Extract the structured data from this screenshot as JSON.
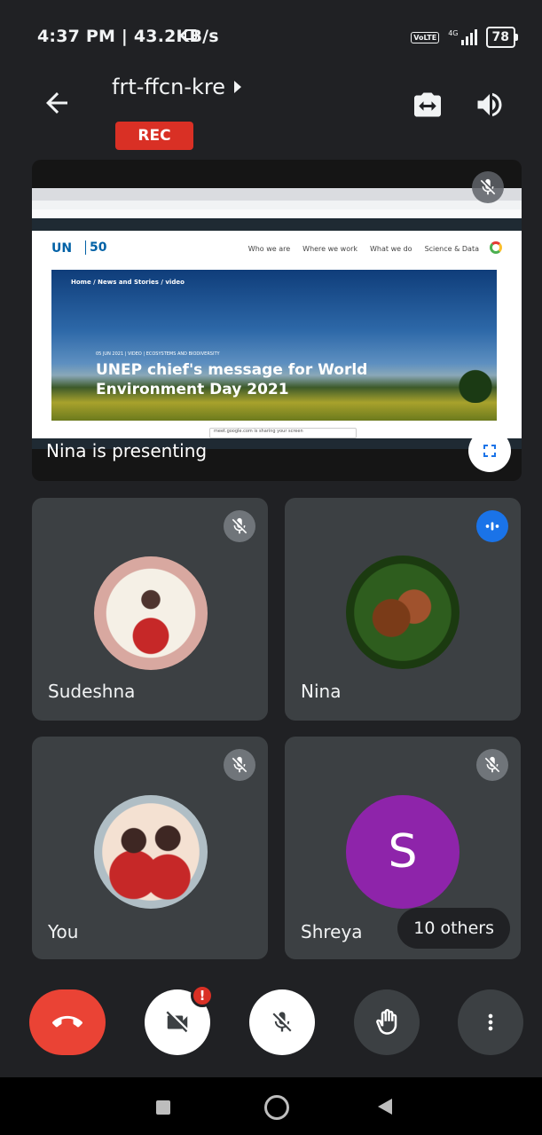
{
  "status_bar": {
    "time_speed": "4:37 PM | 43.2KB/s",
    "volte": "VoLTE",
    "network": "4G",
    "battery": "78"
  },
  "header": {
    "meeting_code": "frt-ffcn-kre",
    "rec_label": "REC"
  },
  "presentation": {
    "presenter_label": "Nina is presenting",
    "screen": {
      "breadcrumb": "Home / News and Stories / video",
      "date_line": "05 JUN 2021 | VIDEO | ECOSYSTEMS AND BIODIVERSITY",
      "headline": "UNEP chief's message for World Environment Day 2021",
      "logo_un": "UN",
      "logo_50": "50",
      "nav_links": [
        "Who we are",
        "Where we work",
        "What we do",
        "Science & Data"
      ],
      "share_text": "meet.google.com is sharing your screen"
    }
  },
  "participants": [
    {
      "name": "Sudeshna",
      "status": "muted"
    },
    {
      "name": "Nina",
      "status": "speaking"
    },
    {
      "name": "You",
      "status": "muted"
    },
    {
      "name": "Shreya",
      "status": "muted",
      "initial": "S"
    }
  ],
  "others_label": "10 others",
  "controls": {
    "camera_badge": "!"
  },
  "colors": {
    "background": "#202124",
    "tile": "#3c4043",
    "end_call": "#ea4335",
    "rec": "#d93025",
    "speaking": "#1a73e8",
    "avatar_shreya": "#8e24aa"
  }
}
